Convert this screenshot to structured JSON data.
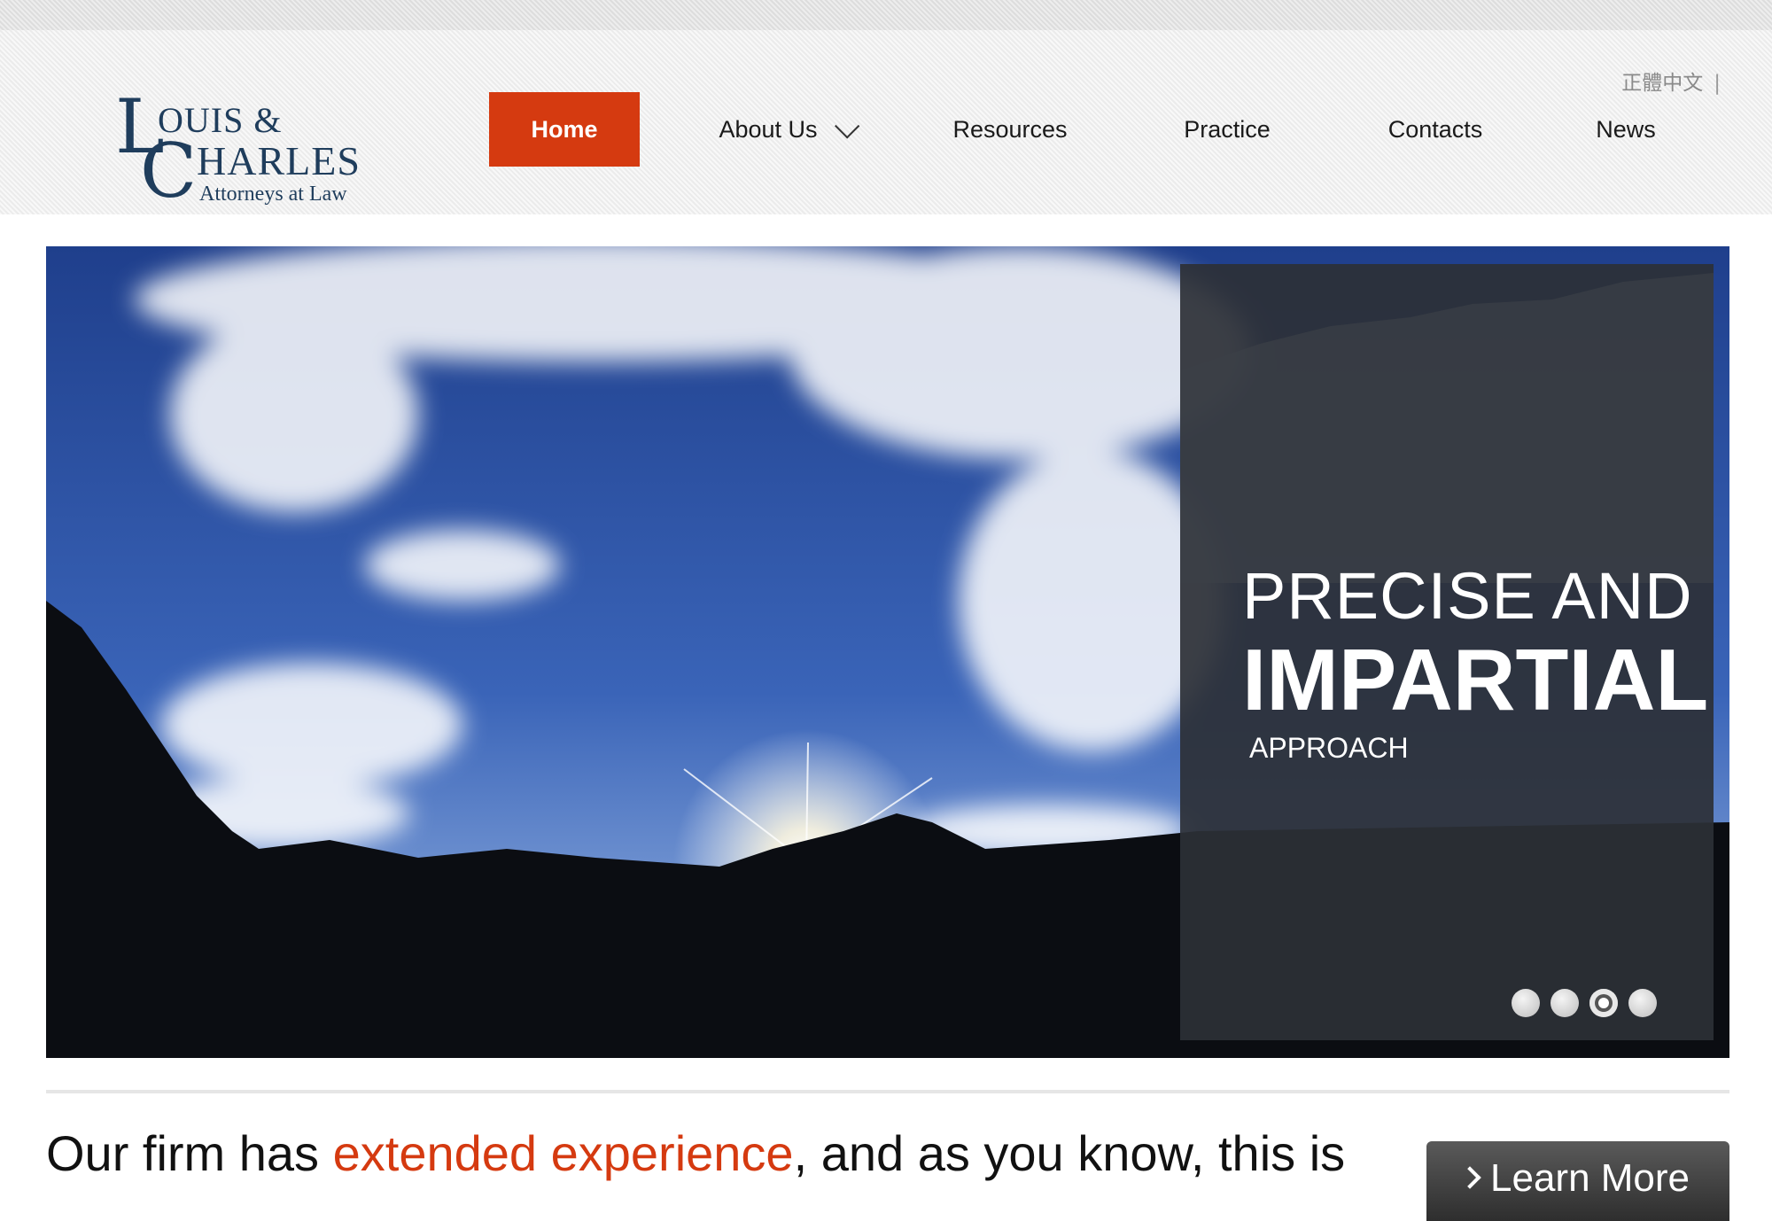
{
  "header": {
    "language_link": "正體中文",
    "separator": "|",
    "logo": {
      "initial_l": "L",
      "initial_c": "C",
      "word1": "OUIS &",
      "word2": "HARLES",
      "tagline": "Attorneys at Law"
    },
    "nav": [
      {
        "label": "Home",
        "active": true
      },
      {
        "label": "About Us",
        "active": false,
        "has_dropdown": true
      },
      {
        "label": "Resources",
        "active": false
      },
      {
        "label": "Practice",
        "active": false
      },
      {
        "label": "Contacts",
        "active": false
      },
      {
        "label": "News",
        "active": false
      }
    ]
  },
  "hero": {
    "line1": "PRECISE AND",
    "line2": "IMPARTIAL",
    "line3": "APPROACH",
    "slides_count": 4,
    "active_slide": 3
  },
  "intro": {
    "text_before": "Our firm has ",
    "highlight": "extended experience",
    "text_after": ", and as you know, this is",
    "button_label": "Learn More"
  },
  "colors": {
    "accent": "#d53a10",
    "logo_navy": "#1f3d5c",
    "panel": "#2d3036"
  }
}
